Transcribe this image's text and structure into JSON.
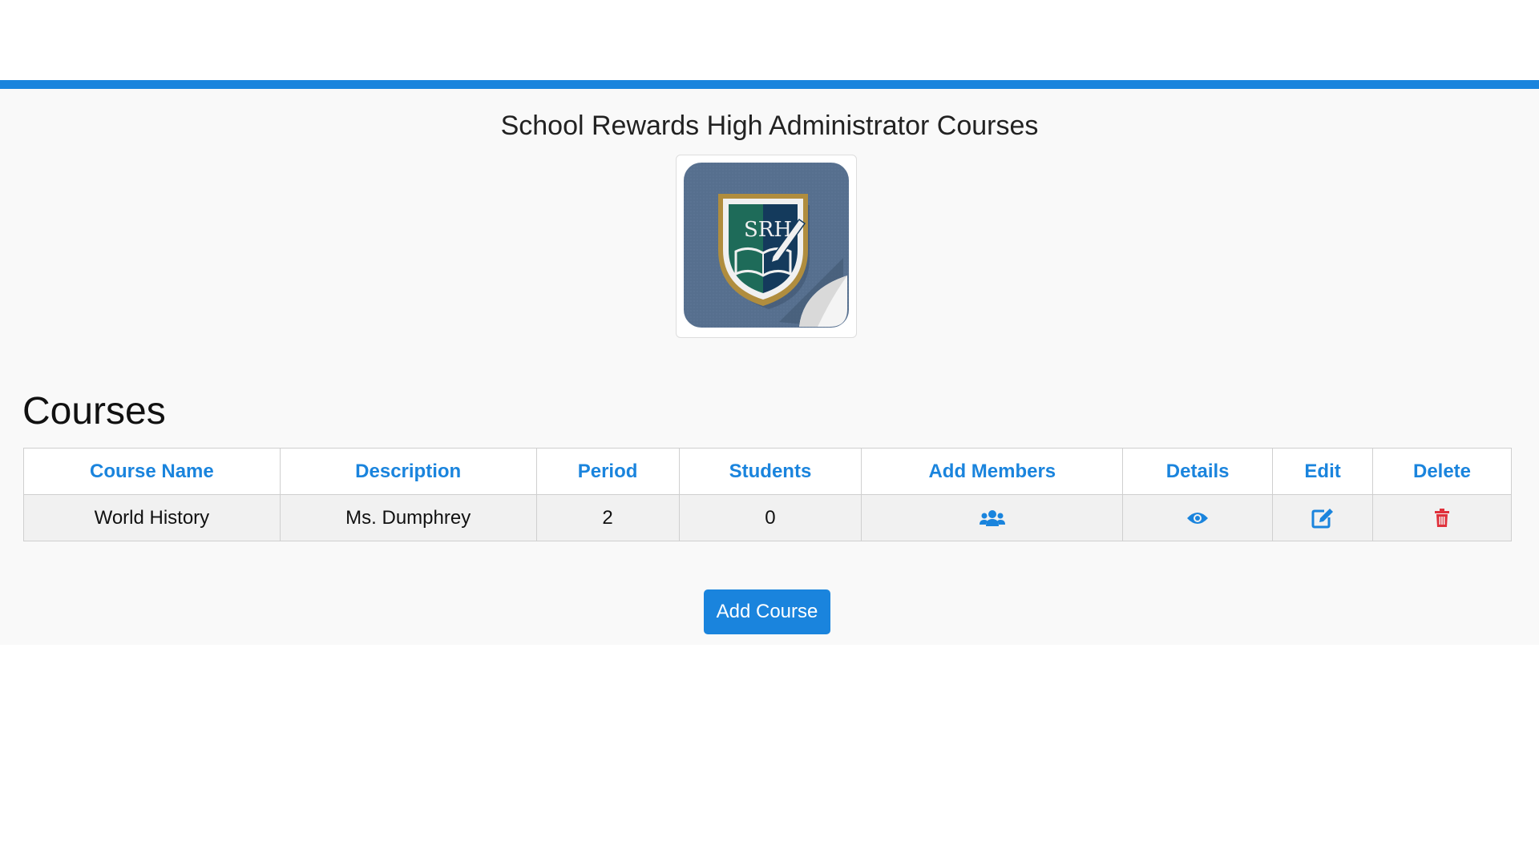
{
  "header": {
    "title": "School Rewards High Administrator Courses",
    "logo_text": "SRH",
    "accent_color": "#1a84dd"
  },
  "section": {
    "title": "Courses"
  },
  "table": {
    "columns": [
      "Course Name",
      "Description",
      "Period",
      "Students",
      "Add Members",
      "Details",
      "Edit",
      "Delete"
    ],
    "rows": [
      {
        "course_name": "World History",
        "description": "Ms. Dumphrey",
        "period": "2",
        "students": "0",
        "add_members_icon": "users-icon",
        "details_icon": "eye-icon",
        "edit_icon": "edit-icon",
        "delete_icon": "trash-icon"
      }
    ]
  },
  "actions": {
    "add_course_label": "Add Course"
  },
  "colors": {
    "link_blue": "#1a84dd",
    "delete_red": "#e0313c"
  }
}
